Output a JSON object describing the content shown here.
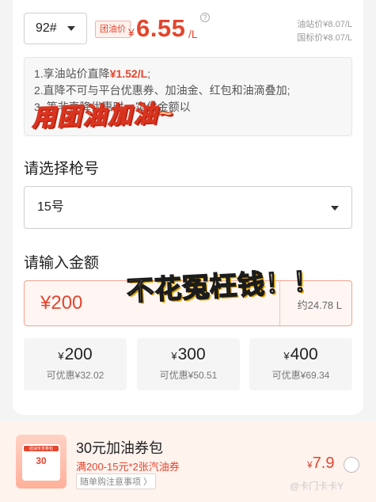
{
  "fuel": {
    "grade": "92#"
  },
  "price": {
    "tag": "团油价",
    "currency": "¥",
    "value": "6.55",
    "unit": "/L",
    "help": "?",
    "station_price": "油站价¥8.07/L",
    "national_price": "国标价¥8.07/L"
  },
  "notice": {
    "line1_prefix": "1.享油站价直降",
    "line1_highlight": "¥1.52/L",
    "line1_suffix": ";",
    "line2": "2.直降不可与平台优惠券、加油金、红包和油滴叠加;",
    "line3": "3.                              等非直降优惠时，实付金额以"
  },
  "overlays": {
    "text1": "用团油加油~",
    "text2": "不花冤枉钱！！"
  },
  "nozzle": {
    "title": "请选择枪号",
    "value": "15号"
  },
  "amount": {
    "title": "请输入金额",
    "value": "¥200",
    "liters": "约24.78 L"
  },
  "options": [
    {
      "amount": "200",
      "currency": "¥",
      "discount": "可优惠¥32.02"
    },
    {
      "amount": "300",
      "currency": "¥",
      "discount": "可优惠¥50.51"
    },
    {
      "amount": "400",
      "currency": "¥",
      "discount": "可优惠¥69.34"
    }
  ],
  "bundle": {
    "image_header": "团油专享券包",
    "image_value": "30",
    "title": "30元加油券包",
    "desc": "满200-15元*2张汽油券",
    "note": "随单购注意事项 〉",
    "currency": "¥",
    "price": "7.9"
  },
  "watermark": "@卡门卡卡Y",
  "colors": {
    "accent": "#e4452d",
    "bg": "#f4f4f4",
    "bundle_bg": "#fff3ee"
  }
}
